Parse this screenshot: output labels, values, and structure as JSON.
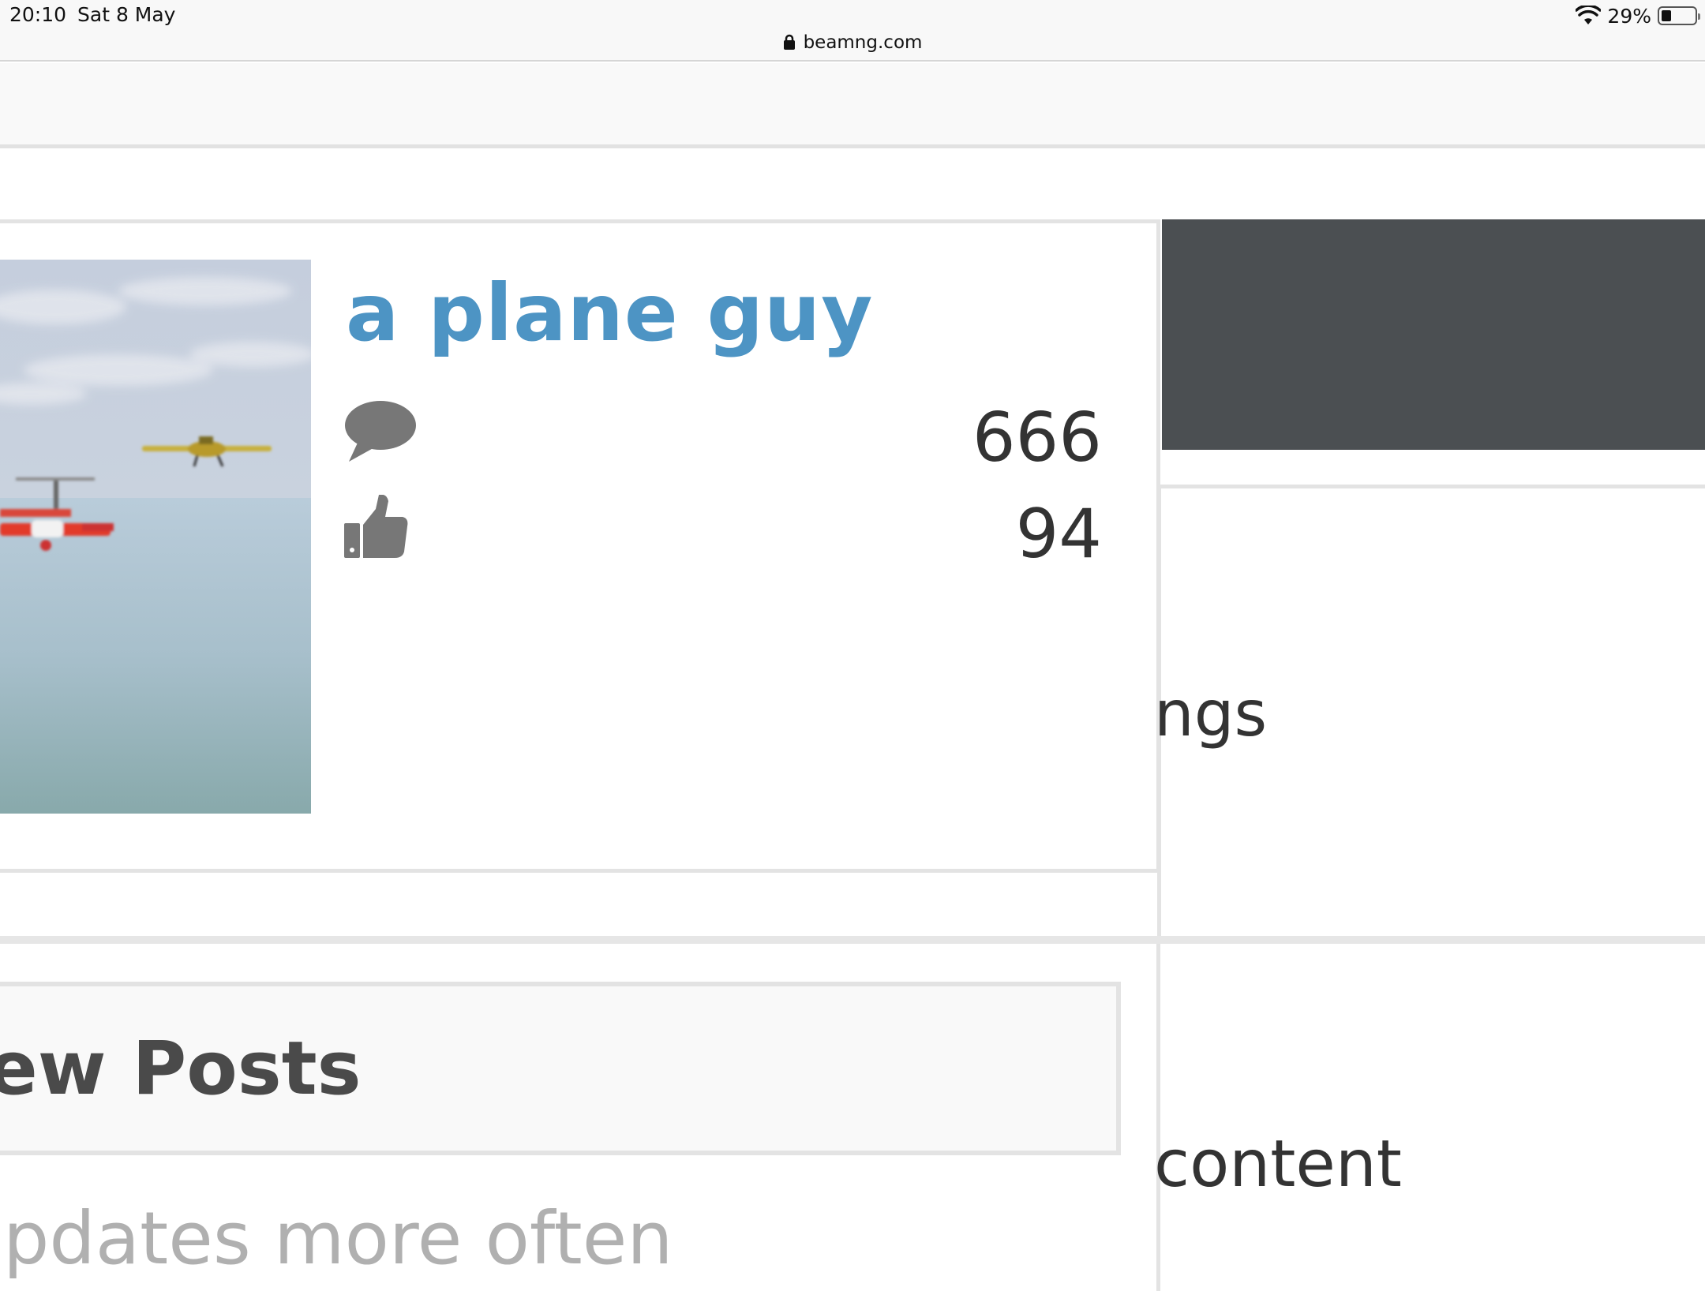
{
  "status_bar": {
    "time": "20:10",
    "date": "Sat 8 May",
    "battery_percent": "29%",
    "battery_level": 0.29
  },
  "browser": {
    "url": "beamng.com"
  },
  "profile": {
    "username": "a plane guy",
    "username_color": "#4d94c4",
    "stats": [
      {
        "icon": "speech-bubble-icon",
        "value": "666"
      },
      {
        "icon": "thumbs-up-icon",
        "value": "94"
      }
    ]
  },
  "sidebar": {
    "dark_panel_color": "#4b4f52",
    "partial_label_1": "ngs",
    "partial_label_2": "content"
  },
  "main": {
    "section_heading": "ew Posts",
    "teaser": "pdates more often"
  }
}
